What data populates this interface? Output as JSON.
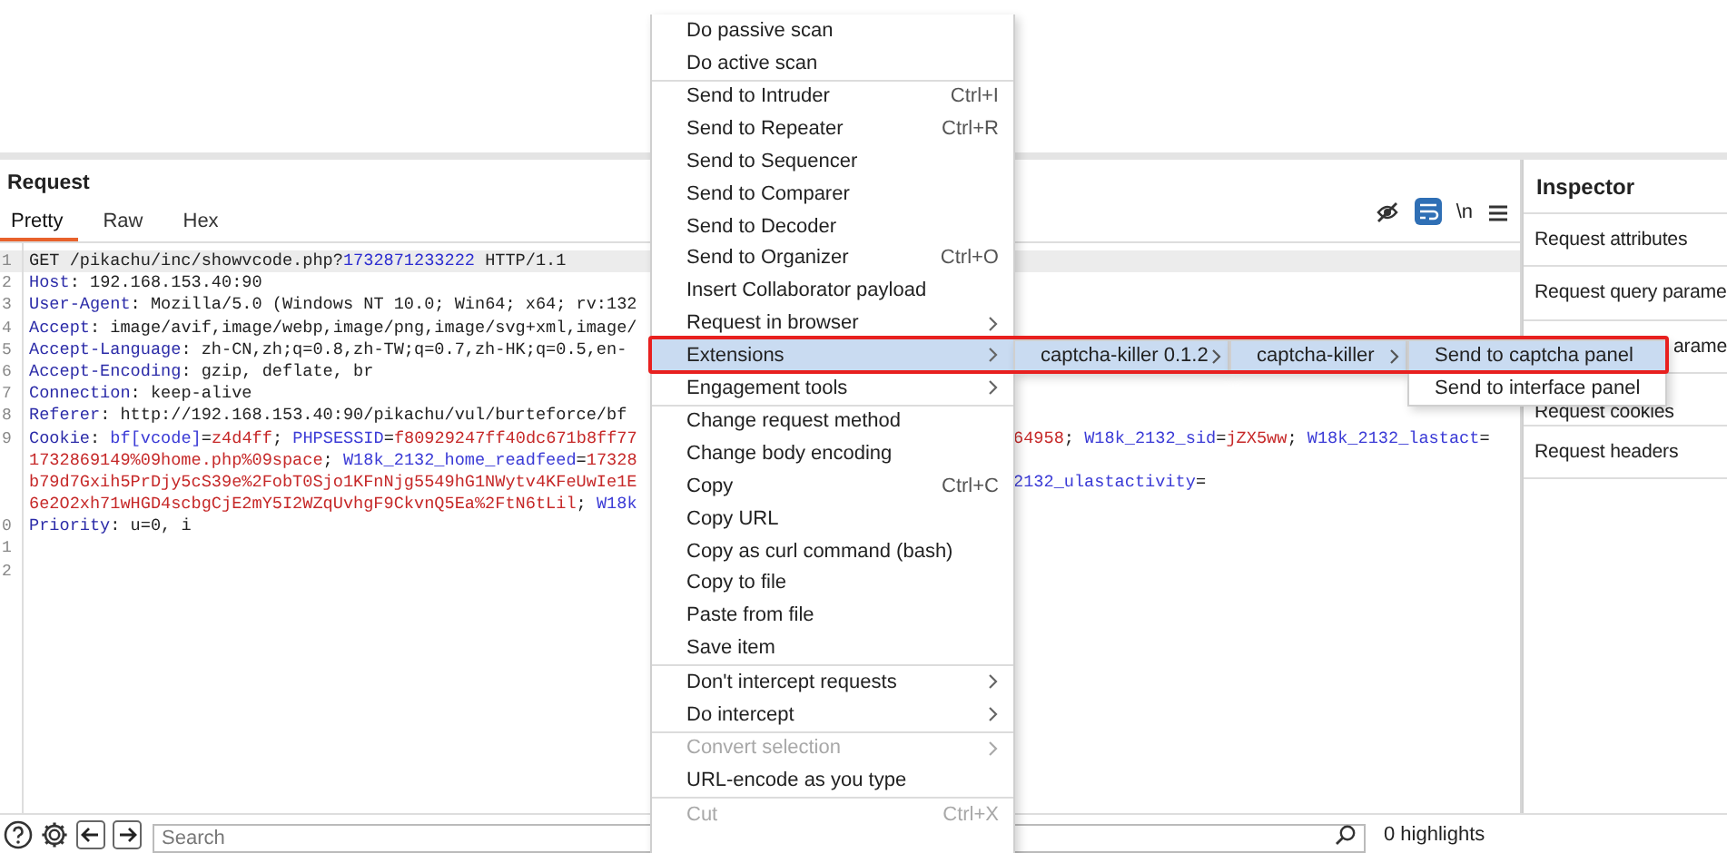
{
  "request": {
    "title": "Request",
    "tabs": [
      {
        "label": "Pretty",
        "selected": true
      },
      {
        "label": "Raw",
        "selected": false
      },
      {
        "label": "Hex",
        "selected": false
      }
    ],
    "toolbar": {
      "wrap_active": true,
      "newline_label": "\\n"
    },
    "lines": [
      {
        "number": "1",
        "current": true,
        "left": [
          {
            "kind": "plain",
            "text": "GET /pikachu/inc/showvcode.php?"
          },
          {
            "kind": "num",
            "text": "1732871233222"
          },
          {
            "kind": "plain",
            "text": " HTTP/1.1"
          }
        ]
      },
      {
        "number": "2",
        "current": false,
        "left": [
          {
            "kind": "key",
            "text": "Host"
          },
          {
            "kind": "plain",
            "text": ": 192.168.153.40:90"
          }
        ]
      },
      {
        "number": "3",
        "current": false,
        "left": [
          {
            "kind": "key",
            "text": "User-Agent"
          },
          {
            "kind": "plain",
            "text": ": Mozilla/5.0 (Windows NT 10.0; Win64; x64; rv:132"
          }
        ]
      },
      {
        "number": "4",
        "current": false,
        "left": [
          {
            "kind": "key",
            "text": "Accept"
          },
          {
            "kind": "plain",
            "text": ": image/avif,image/webp,image/png,image/svg+xml,image/"
          }
        ]
      },
      {
        "number": "5",
        "current": false,
        "left": [
          {
            "kind": "key",
            "text": "Accept-Language"
          },
          {
            "kind": "plain",
            "text": ": zh-CN,zh;q=0.8,zh-TW;q=0.7,zh-HK;q=0.5,en-"
          }
        ]
      },
      {
        "number": "6",
        "current": false,
        "left": [
          {
            "kind": "key",
            "text": "Accept-Encoding"
          },
          {
            "kind": "plain",
            "text": ": gzip, deflate, br"
          }
        ]
      },
      {
        "number": "7",
        "current": false,
        "left": [
          {
            "kind": "key",
            "text": "Connection"
          },
          {
            "kind": "plain",
            "text": ": keep-alive"
          }
        ]
      },
      {
        "number": "8",
        "current": false,
        "left": [
          {
            "kind": "key",
            "text": "Referer"
          },
          {
            "kind": "plain",
            "text": ": http://192.168.153.40:90/pikachu/vul/burteforce/bf"
          }
        ]
      },
      {
        "number": "9",
        "current": false,
        "left": [
          {
            "kind": "key",
            "text": "Cookie"
          },
          {
            "kind": "plain",
            "text": ": "
          },
          {
            "kind": "name",
            "text": "bf[vcode]"
          },
          {
            "kind": "plain",
            "text": "="
          },
          {
            "kind": "value",
            "text": "z4d4ff"
          },
          {
            "kind": "plain",
            "text": "; "
          },
          {
            "kind": "name",
            "text": "PHPSESSID"
          },
          {
            "kind": "plain",
            "text": "="
          },
          {
            "kind": "value",
            "text": "f80929247ff40dc671b8ff77"
          }
        ],
        "right": [
          {
            "kind": "value",
            "text": "64958"
          },
          {
            "kind": "plain",
            "text": "; "
          },
          {
            "kind": "name",
            "text": "W18k_2132_sid"
          },
          {
            "kind": "plain",
            "text": "="
          },
          {
            "kind": "value",
            "text": "jZX5ww"
          },
          {
            "kind": "plain",
            "text": "; "
          },
          {
            "kind": "name",
            "text": "W18k_2132_lastact"
          },
          {
            "kind": "plain",
            "text": "="
          }
        ]
      },
      {
        "current": false,
        "left": [
          {
            "kind": "value",
            "text": "1732869149%09home.php%09space"
          },
          {
            "kind": "plain",
            "text": "; "
          },
          {
            "kind": "name",
            "text": "W18k_2132_home_readfeed"
          },
          {
            "kind": "plain",
            "text": "="
          },
          {
            "kind": "value",
            "text": "17328"
          }
        ]
      },
      {
        "current": false,
        "left": [
          {
            "kind": "value",
            "text": "b79d7Gxih5PrDjy5cS39e%2FobT0Sjo1KFnNjg5549hG1NWytv4KFeUwIe1E"
          }
        ],
        "right": [
          {
            "kind": "name",
            "text": "2132_ulastactivity"
          },
          {
            "kind": "plain",
            "text": "="
          }
        ]
      },
      {
        "current": false,
        "left": [
          {
            "kind": "value",
            "text": "6e2O2xh71wHGD4scbgCjE2mY5I2WZqUvhgF9CkvnQ5Ea%2FtN6tLil"
          },
          {
            "kind": "plain",
            "text": "; "
          },
          {
            "kind": "name",
            "text": "W18k"
          }
        ]
      },
      {
        "number": "0",
        "current": false,
        "left": [
          {
            "kind": "key",
            "text": "Priority"
          },
          {
            "kind": "plain",
            "text": ": u=0, i"
          }
        ]
      },
      {
        "number": "1",
        "current": false
      },
      {
        "number": "2",
        "current": false
      }
    ]
  },
  "inspector": {
    "title": "Inspector",
    "items": [
      {
        "label": "Request attributes",
        "kind": "full"
      },
      {
        "label": "Request query parame",
        "kind": "full"
      },
      {
        "label": "arame",
        "kind": "tail"
      },
      {
        "label": "Request cookies",
        "kind": "full"
      },
      {
        "label": "Request headers",
        "kind": "full"
      }
    ]
  },
  "footer": {
    "search": {
      "placeholder": "Search"
    },
    "highlights": "0 highlights"
  },
  "context_menu": {
    "groups": [
      {
        "items": [
          {
            "label": "Do passive scan",
            "selected": false,
            "disabled": false,
            "has_submenu": false
          },
          {
            "label": "Do active scan",
            "selected": false,
            "disabled": false,
            "has_submenu": false
          }
        ]
      },
      {
        "items": [
          {
            "label": "Send to Intruder",
            "shortcut": "Ctrl+I",
            "selected": false,
            "disabled": false,
            "has_submenu": false
          },
          {
            "label": "Send to Repeater",
            "shortcut": "Ctrl+R",
            "selected": false,
            "disabled": false,
            "has_submenu": false
          },
          {
            "label": "Send to Sequencer",
            "selected": false,
            "disabled": false,
            "has_submenu": false
          },
          {
            "label": "Send to Comparer",
            "selected": false,
            "disabled": false,
            "has_submenu": false
          },
          {
            "label": "Send to Decoder",
            "selected": false,
            "disabled": false,
            "has_submenu": false
          },
          {
            "label": "Send to Organizer",
            "shortcut": "Ctrl+O",
            "selected": false,
            "disabled": false,
            "has_submenu": false
          },
          {
            "label": "Insert Collaborator payload",
            "selected": false,
            "disabled": false,
            "has_submenu": false
          },
          {
            "label": "Request in browser",
            "selected": false,
            "disabled": false,
            "has_submenu": true
          },
          {
            "label": "Extensions",
            "selected": true,
            "disabled": false,
            "has_submenu": true
          },
          {
            "label": "Engagement tools",
            "selected": false,
            "disabled": false,
            "has_submenu": true
          }
        ]
      },
      {
        "items": [
          {
            "label": "Change request method",
            "selected": false,
            "disabled": false,
            "has_submenu": false
          },
          {
            "label": "Change body encoding",
            "selected": false,
            "disabled": false,
            "has_submenu": false
          },
          {
            "label": "Copy",
            "shortcut": "Ctrl+C",
            "selected": false,
            "disabled": false,
            "has_submenu": false
          },
          {
            "label": "Copy URL",
            "selected": false,
            "disabled": false,
            "has_submenu": false
          },
          {
            "label": "Copy as curl command (bash)",
            "selected": false,
            "disabled": false,
            "has_submenu": false
          },
          {
            "label": "Copy to file",
            "selected": false,
            "disabled": false,
            "has_submenu": false
          },
          {
            "label": "Paste from file",
            "selected": false,
            "disabled": false,
            "has_submenu": false
          },
          {
            "label": "Save item",
            "selected": false,
            "disabled": false,
            "has_submenu": false
          }
        ]
      },
      {
        "items": [
          {
            "label": "Don't intercept requests",
            "selected": false,
            "disabled": false,
            "has_submenu": true
          },
          {
            "label": "Do intercept",
            "selected": false,
            "disabled": false,
            "has_submenu": true
          }
        ]
      },
      {
        "items": [
          {
            "label": "Convert selection",
            "selected": false,
            "disabled": true,
            "has_submenu": true
          },
          {
            "label": "URL-encode as you type",
            "selected": false,
            "disabled": false,
            "has_submenu": false
          }
        ]
      },
      {
        "items": [
          {
            "label": "Cut",
            "shortcut": "Ctrl+X",
            "selected": false,
            "disabled": true,
            "has_submenu": false
          }
        ]
      }
    ]
  },
  "submenus": [
    {
      "items": [
        {
          "label": "captcha-killer 0.1.2",
          "selected": true,
          "has_submenu": true
        }
      ]
    },
    {
      "items": [
        {
          "label": "captcha-killer",
          "selected": true,
          "has_submenu": true
        }
      ]
    },
    {
      "items": [
        {
          "label": "Send to captcha panel",
          "selected": true,
          "has_submenu": false
        },
        {
          "label": "Send to interface panel",
          "selected": false,
          "has_submenu": false
        }
      ]
    }
  ]
}
